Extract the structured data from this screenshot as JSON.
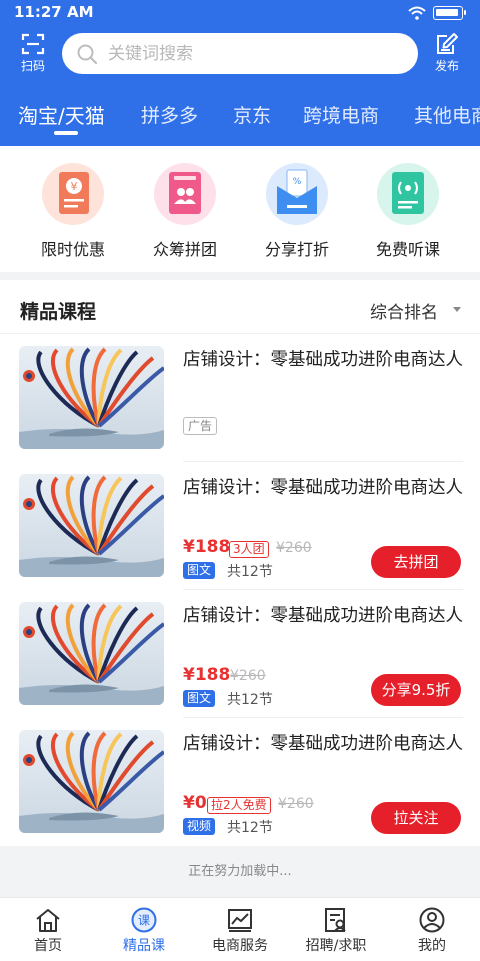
{
  "status_bar": {
    "time": "11:27 AM"
  },
  "header": {
    "scan_label": "扫码",
    "post_label": "发布",
    "search_placeholder": "关键词搜索"
  },
  "category_tabs": [
    {
      "label": "淘宝/天猫",
      "active": true
    },
    {
      "label": "拼多多",
      "active": false
    },
    {
      "label": "京东",
      "active": false
    },
    {
      "label": "跨境电商",
      "active": false
    },
    {
      "label": "其他电商",
      "active": false
    }
  ],
  "features": [
    {
      "label": "限时优惠",
      "icon": "coupon-icon",
      "color": "#f07a5a"
    },
    {
      "label": "众筹拼团",
      "icon": "group-ticket-icon",
      "color": "#f05a8a"
    },
    {
      "label": "分享打折",
      "icon": "share-discount-icon",
      "color": "#3d8ef0"
    },
    {
      "label": "免费听课",
      "icon": "free-audio-icon",
      "color": "#2ec5a0"
    }
  ],
  "section": {
    "title": "精品课程",
    "sort_label": "综合排名"
  },
  "courses": [
    {
      "title": "店铺设计：零基础成功进阶电商达人",
      "ad_tag": "广告"
    },
    {
      "title": "店铺设计：零基础成功进阶电商达人",
      "price": "¥188",
      "promo": "3人团",
      "old_price": "¥260",
      "type": "图文",
      "lessons": "共12节",
      "action": "去拼团"
    },
    {
      "title": "店铺设计：零基础成功进阶电商达人",
      "price": "¥188",
      "old_price": "¥260",
      "type": "图文",
      "lessons": "共12节",
      "action": "分享9.5折"
    },
    {
      "title": "店铺设计：零基础成功进阶电商达人",
      "price": "¥0",
      "promo": "拉2人免费",
      "old_price": "¥260",
      "type": "视频",
      "lessons": "共12节",
      "action": "拉关注"
    }
  ],
  "loading_text": "正在努力加载中...",
  "tabbar": [
    {
      "label": "首页",
      "icon": "home-icon",
      "active": false
    },
    {
      "label": "精品课",
      "icon": "course-icon",
      "active": true
    },
    {
      "label": "电商服务",
      "icon": "chart-icon",
      "active": false
    },
    {
      "label": "招聘/求职",
      "icon": "resume-icon",
      "active": false
    },
    {
      "label": "我的",
      "icon": "user-icon",
      "active": false
    }
  ],
  "colors": {
    "brand": "#2f6fe8",
    "price_red": "#e83131",
    "button_red": "#e6202a"
  }
}
